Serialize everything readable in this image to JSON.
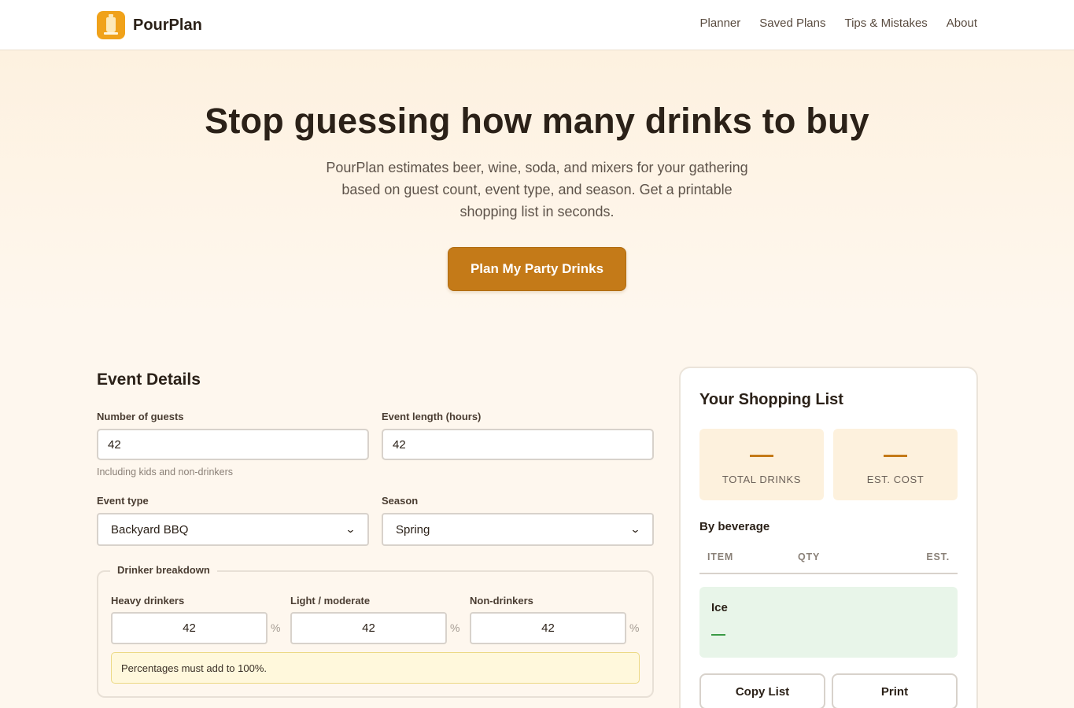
{
  "header": {
    "brand": "PourPlan",
    "nav": [
      "Planner",
      "Saved Plans",
      "Tips & Mistakes",
      "About"
    ]
  },
  "hero": {
    "title": "Stop guessing how many drinks to buy",
    "subtitle": "PourPlan estimates beer, wine, soda, and mixers for your gathering based on guest count, event type, and season. Get a printable shopping list in seconds.",
    "cta": "Plan My Party Drinks"
  },
  "event": {
    "title": "Event Details",
    "guests_label": "Number of guests",
    "guests_value": "42",
    "guests_hint": "Including kids and non-drinkers",
    "length_label": "Event length (hours)",
    "length_value": "42",
    "type_label": "Event type",
    "type_value": "Backyard BBQ",
    "season_label": "Season",
    "season_value": "Spring",
    "breakdown": {
      "legend": "Drinker breakdown",
      "heavy_label": "Heavy drinkers",
      "heavy_value": "42",
      "light_label": "Light / moderate",
      "light_value": "42",
      "non_label": "Non-drinkers",
      "non_value": "42",
      "unit": "%",
      "warning": "Percentages must add to 100%."
    }
  },
  "shopping": {
    "title": "Your Shopping List",
    "total_label": "TOTAL DRINKS",
    "cost_label": "EST. COST",
    "by_beverage": "By beverage",
    "columns": [
      "ITEM",
      "QTY",
      "EST."
    ],
    "rows": [
      {
        "item": "Ice"
      }
    ],
    "copy_label": "Copy List",
    "print_label": "Print"
  },
  "colors": {
    "accent": "#c47a18",
    "logo": "#f0a21a",
    "ice_row": "#e8f5e9",
    "warning_bg": "#fff8dc"
  }
}
